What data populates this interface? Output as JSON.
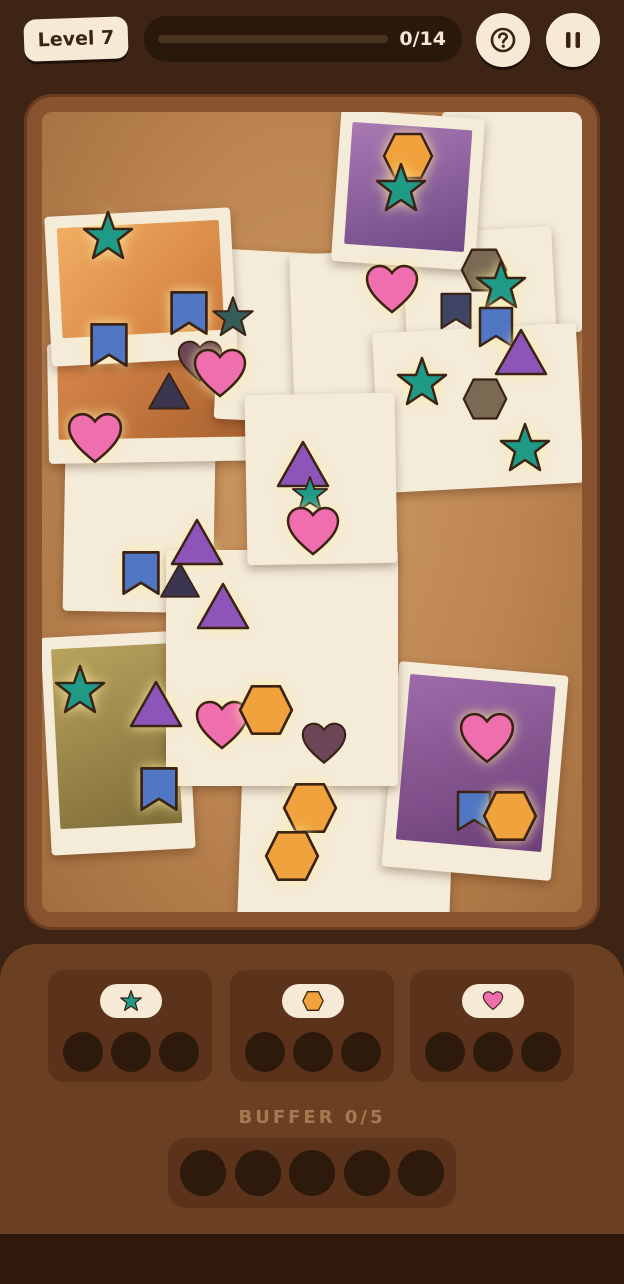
{
  "header": {
    "level_label": "Level 7",
    "progress_text": "0/14",
    "progress_fraction": 0,
    "help_icon": "question-circle-icon",
    "pause_icon": "pause-icon"
  },
  "palette": {
    "star": "#1f9a86",
    "hexagon": "#f0a23c",
    "heart": "#ef6fae",
    "triangle": "#8d55b9",
    "bookmark": "#5177c4",
    "outline": "#3a2214"
  },
  "bins": [
    {
      "icon": "star-icon",
      "filled": 0,
      "capacity": 3
    },
    {
      "icon": "hexagon-icon",
      "filled": 0,
      "capacity": 3
    },
    {
      "icon": "heart-icon",
      "filled": 0,
      "capacity": 3
    }
  ],
  "buffer": {
    "label": "BUFFER 0/5",
    "filled": 0,
    "capacity": 5
  }
}
